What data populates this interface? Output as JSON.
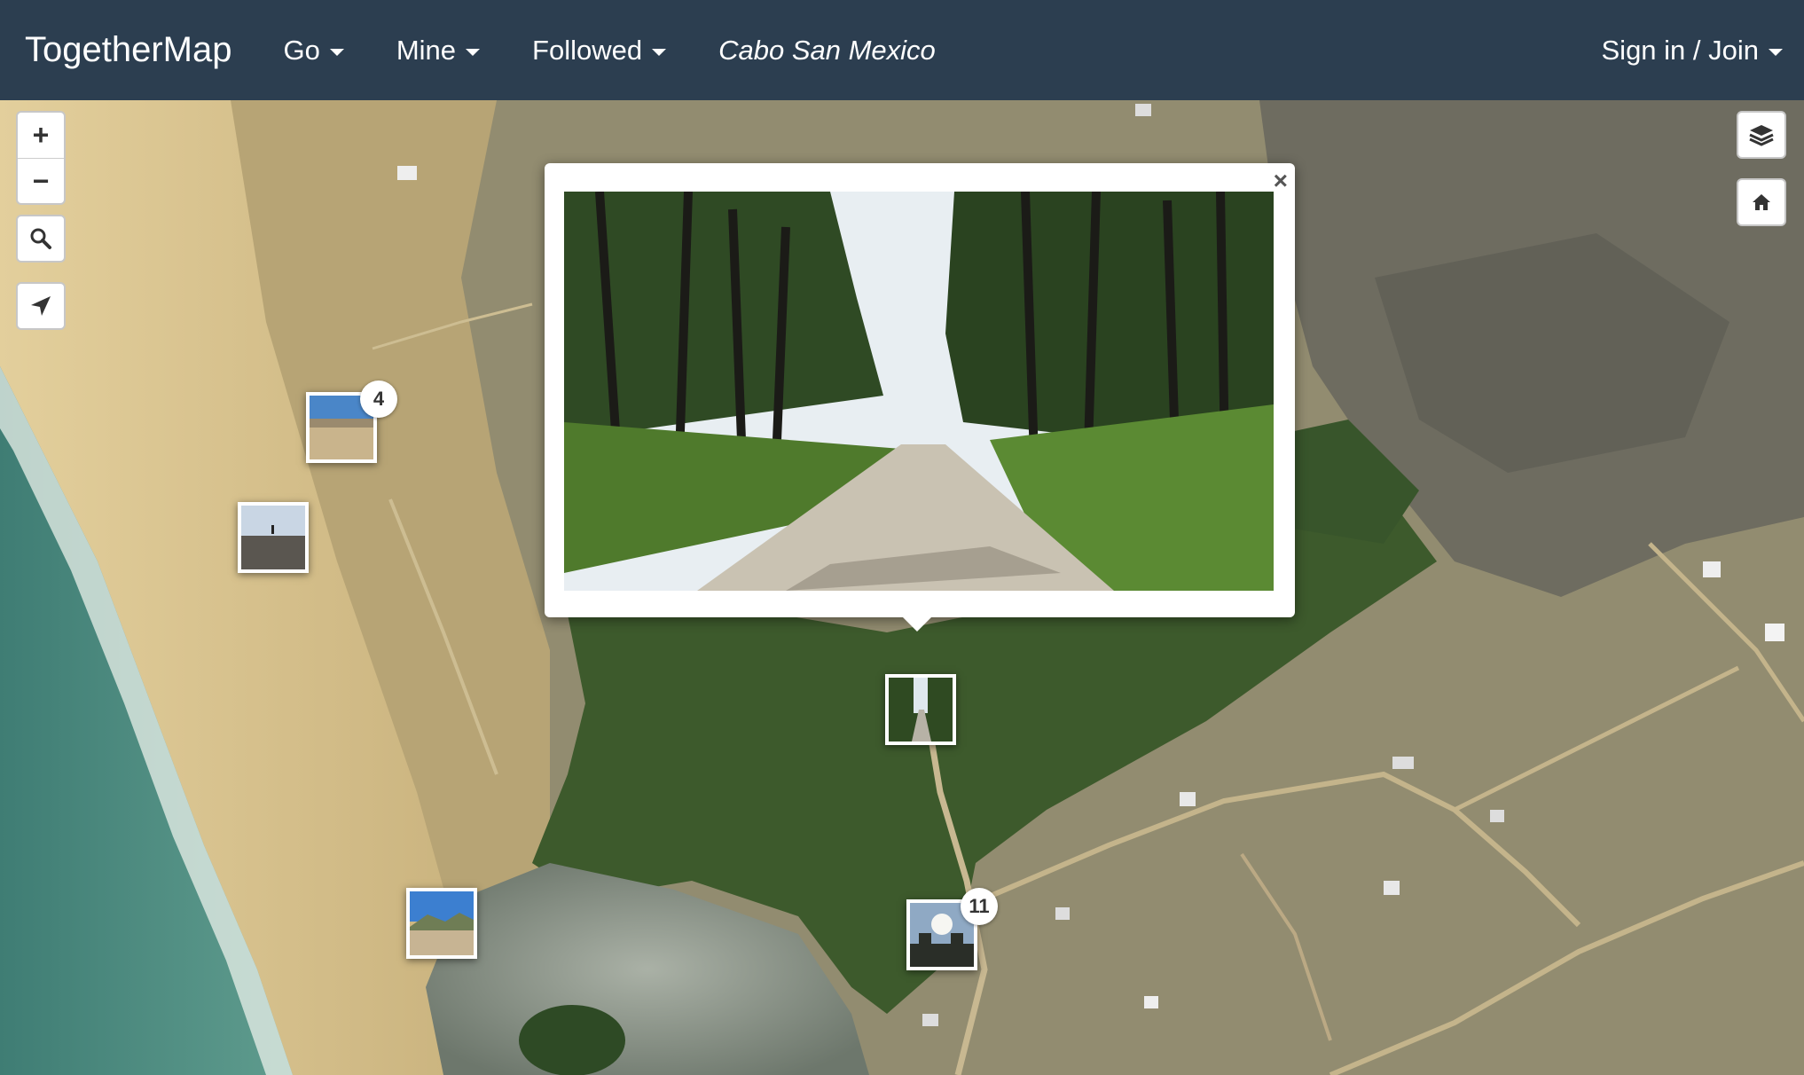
{
  "navbar": {
    "brand": "TogetherMap",
    "menus": [
      {
        "label": "Go"
      },
      {
        "label": "Mine"
      },
      {
        "label": "Followed"
      }
    ],
    "map_title": "Cabo San Mexico",
    "account_label": "Sign in / Join"
  },
  "map_controls": {
    "zoom_in": "+",
    "zoom_out": "−",
    "search_icon": "search-icon",
    "locate_icon": "location-arrow-icon",
    "layers_icon": "layers-icon",
    "home_icon": "home-icon"
  },
  "markers": [
    {
      "name": "photo-marker-beach-cluster",
      "count": "4"
    },
    {
      "name": "photo-marker-beach-walk",
      "count": ""
    },
    {
      "name": "photo-marker-palm-path",
      "count": ""
    },
    {
      "name": "photo-marker-beach-hills",
      "count": ""
    },
    {
      "name": "photo-marker-sunset-cluster",
      "count": "11"
    }
  ],
  "popup": {
    "close_label": "×",
    "photo_subject": "dirt road through palm grove"
  },
  "colors": {
    "navbar": "#2c3e50",
    "sand": "#d9c28f",
    "ocean": "#4d8a80",
    "vegetation": "#3f5f2e",
    "scrub": "#8f8b72"
  }
}
